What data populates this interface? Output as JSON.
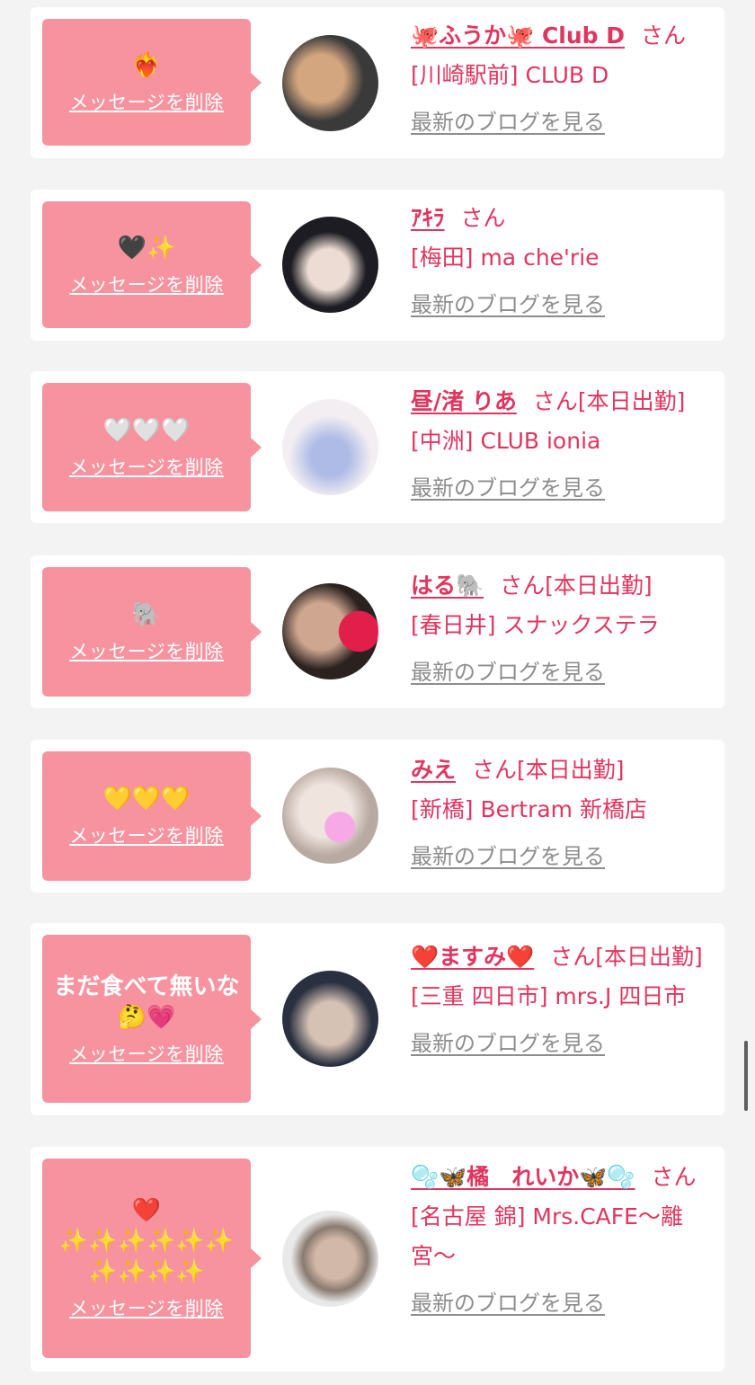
{
  "messages": [
    {
      "bubble_text": "❤️‍🔥",
      "delete_label": "メッセージを削除",
      "name": "🐙ふうか🐙 Club D",
      "san": "さん",
      "work_status": "",
      "shop": "[川崎駅前] CLUB D",
      "blog_label": "最新のブログを見る",
      "avatar_colors": [
        "#3a3a3a",
        "#c79a74"
      ]
    },
    {
      "bubble_text": "🖤✨",
      "delete_label": "メッセージを削除",
      "name": "ｱｷﾗ",
      "san": "さん",
      "work_status": "",
      "shop": "[梅田] ma che'rie",
      "blog_label": "最新のブログを見る",
      "avatar_colors": [
        "#1c1c22",
        "#e8d8d0"
      ]
    },
    {
      "bubble_text": "🤍🤍🤍",
      "delete_label": "メッセージを削除",
      "name": "昼/渚 りあ",
      "san": "さん",
      "work_status": "[本日出勤]",
      "shop": "[中洲] CLUB ionia",
      "blog_label": "最新のブログを見る",
      "avatar_colors": [
        "#f3eef2",
        "#a9b8e6"
      ]
    },
    {
      "bubble_text": "🐘",
      "delete_label": "メッセージを削除",
      "name": "はる🐘",
      "san": "さん",
      "work_status": "[本日出勤]",
      "shop": "[春日井] スナックステラ",
      "blog_label": "最新のブログを見る",
      "avatar_colors": [
        "#2b2220",
        "#e21f4a"
      ]
    },
    {
      "bubble_text": "💛💛💛",
      "delete_label": "メッセージを削除",
      "name": "みえ",
      "san": "さん",
      "work_status": "[本日出勤]",
      "shop": "[新橋] Bertram 新橋店",
      "blog_label": "最新のブログを見る",
      "avatar_colors": [
        "#d9cfc9",
        "#f7a8e6"
      ]
    },
    {
      "bubble_text": "まだ食べて無いな\n🤔💗",
      "delete_label": "メッセージを削除",
      "name": "❤️ますみ❤️",
      "san": "さん",
      "work_status": "[本日出勤]",
      "shop": "[三重 四日市] mrs.J 四日市",
      "blog_label": "最新のブログを見る",
      "avatar_colors": [
        "#2a3040",
        "#c9b7a8"
      ]
    },
    {
      "bubble_text": "❤️\n✨✨✨✨✨✨\n✨✨✨✨",
      "delete_label": "メッセージを削除",
      "name": "🫧🦋橘　れいか🦋🫧",
      "san": "さん",
      "work_status": "",
      "shop": "[名古屋 錦] Mrs.CAFE〜離宮〜",
      "blog_label": "最新のブログを見る",
      "avatar_colors": [
        "#e9e9e9",
        "#8a7a70"
      ]
    }
  ]
}
